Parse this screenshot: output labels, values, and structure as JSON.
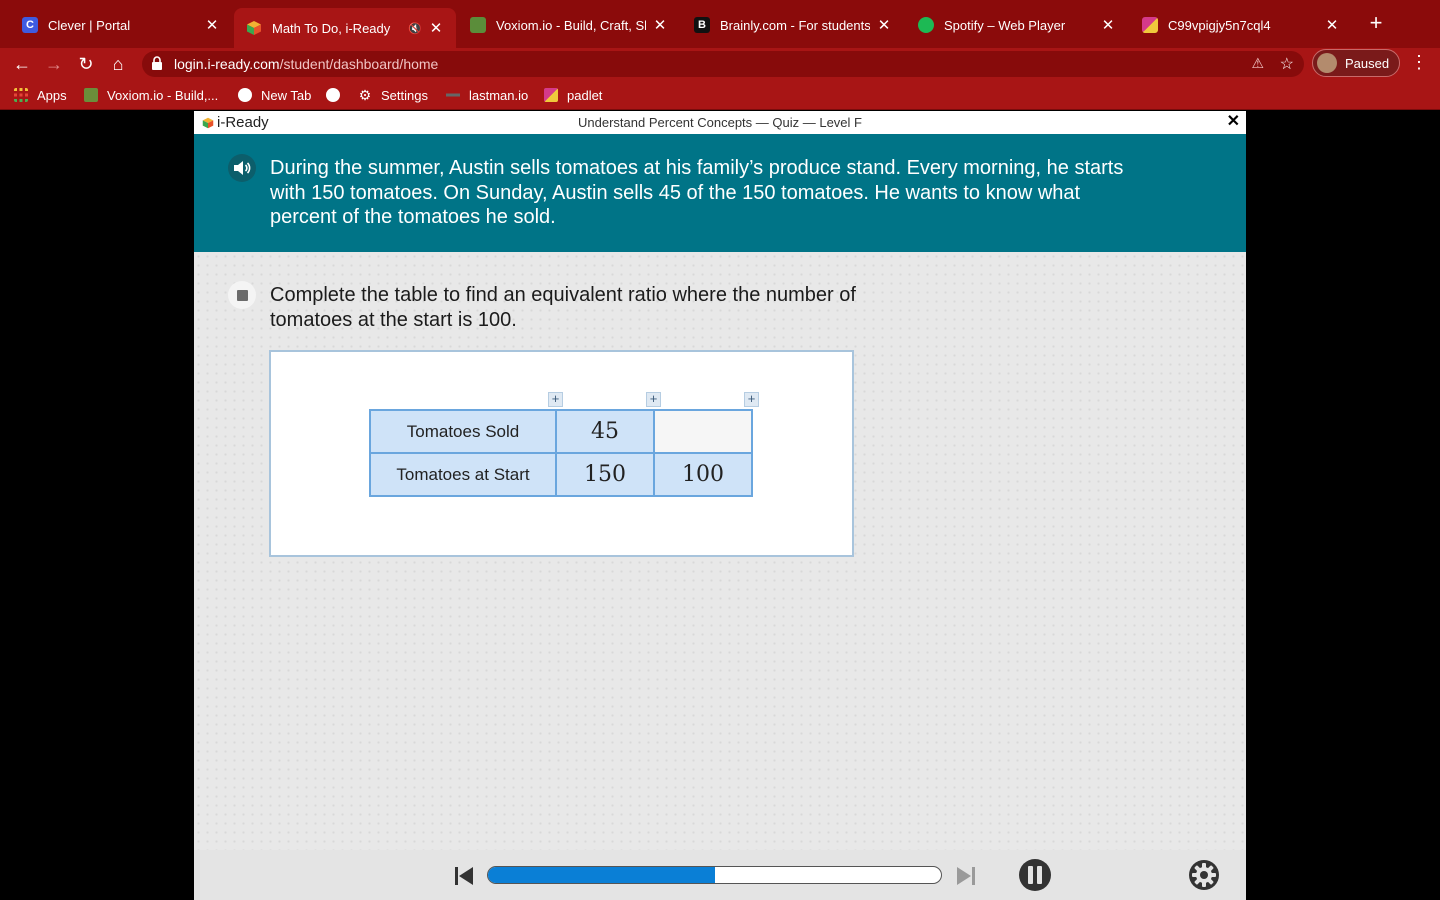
{
  "browser": {
    "tabs": [
      {
        "title": "Clever | Portal",
        "favicon": "clever-icon",
        "color": "#3f5be0",
        "glyph": "C"
      },
      {
        "title": "Math To Do, i-Ready",
        "favicon": "iready-icon",
        "color": "#39a35a",
        "glyph": "",
        "active": true,
        "muted": true
      },
      {
        "title": "Voxiom.io - Build, Craft, Sho",
        "favicon": "voxiom-icon",
        "color": "#5b8d3a",
        "glyph": ""
      },
      {
        "title": "Brainly.com - For students. ",
        "favicon": "brainly-icon",
        "color": "#111111",
        "glyph": "B"
      },
      {
        "title": "Spotify – Web Player",
        "favicon": "spotify-icon",
        "color": "#1db954",
        "glyph": ""
      },
      {
        "title": "C99vpigjy5n7cql4",
        "favicon": "site-icon",
        "color": "#d53a8a",
        "glyph": ""
      }
    ],
    "url_host": "login.i-ready.com",
    "url_path": "/student/dashboard/home",
    "profile_label": "Paused",
    "bookmarks": [
      {
        "label": "Apps",
        "icon": "apps-grid-icon"
      },
      {
        "label": "Voxiom.io - Build,...",
        "icon": "voxiom-icon"
      },
      {
        "label": "New Tab",
        "icon": "new-tab-icon"
      },
      {
        "label": "",
        "icon": "globe-icon"
      },
      {
        "label": "Settings",
        "icon": "settings-gear-icon"
      },
      {
        "label": "lastman.io",
        "icon": "lastman-icon"
      },
      {
        "label": "padlet",
        "icon": "padlet-icon"
      }
    ]
  },
  "app": {
    "logo": "i-Ready",
    "lesson_title": "Understand Percent Concepts — Quiz — Level F",
    "close_symbol": "✕",
    "prompt": "During the summer, Austin sells tomatoes at his family’s produce stand. Every morning, he starts with 150 tomatoes. On Sunday, Austin sells 45 of the 150 tomatoes. He wants to know what percent of the tomatoes he sold.",
    "question": "Complete the table to find an equivalent ratio where the number of tomatoes at the start is 100.",
    "table": {
      "rows": [
        {
          "label": "Tomatoes Sold",
          "values": [
            "45",
            ""
          ]
        },
        {
          "label": "Tomatoes at Start",
          "values": [
            "150",
            "100"
          ]
        }
      ],
      "add_column_symbol": "+"
    },
    "progress": 0.5,
    "accent_teal": "#007487",
    "progress_color": "#0a7fd6"
  }
}
